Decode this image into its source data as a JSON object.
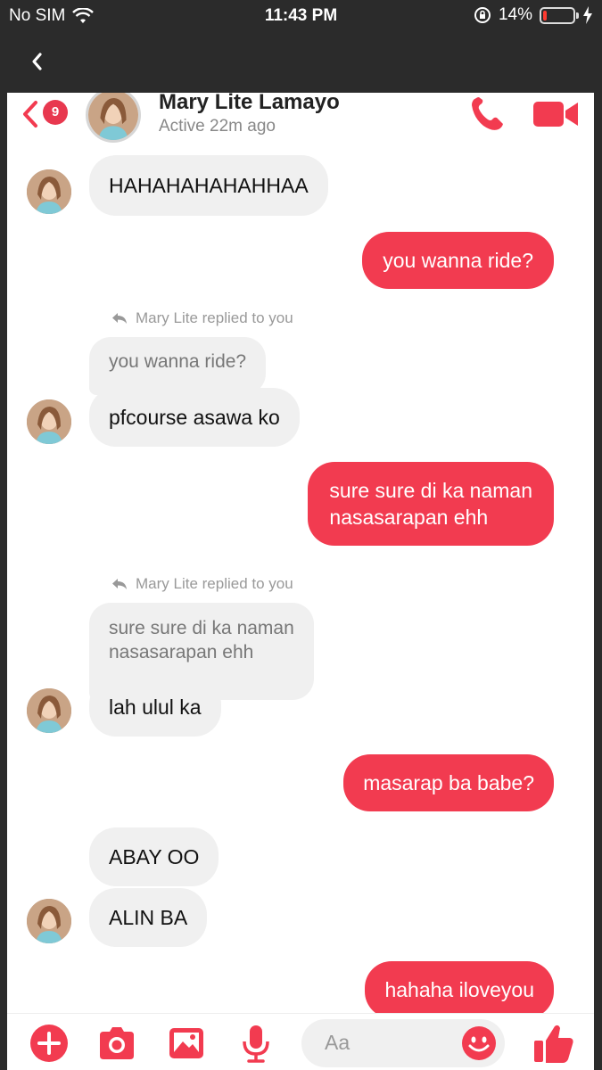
{
  "status_bar": {
    "carrier": "No SIM",
    "time": "11:43 PM",
    "battery": "14%",
    "battery_level": 0.14
  },
  "header": {
    "unread_count": "9",
    "contact_name": "Mary Lite Lamayo",
    "active_status": "Active 22m ago"
  },
  "messages": [
    {
      "side": "in",
      "text": "HAHAHAHAHAHHAA"
    },
    {
      "side": "out",
      "text": "you wanna ride?"
    },
    {
      "reply_note": "Mary Lite replied to you",
      "quoted": "you wanna ride?",
      "side": "in",
      "text": "pfcourse asawa ko"
    },
    {
      "side": "out",
      "lines": [
        "sure sure di ka naman",
        "nasasarapan ehh"
      ]
    },
    {
      "reply_note": "Mary Lite replied to you",
      "quoted_lines": [
        "sure sure di ka naman",
        "nasasarapan ehh"
      ],
      "side": "in",
      "text": "lah ulul ka"
    },
    {
      "side": "out",
      "text": "masarap ba babe?"
    },
    {
      "side": "in",
      "text": "ABAY OO"
    },
    {
      "side": "in",
      "text": "ALIN BA"
    },
    {
      "side": "out",
      "text": "hahaha iloveyou"
    }
  ],
  "composer": {
    "placeholder": "Aa",
    "icons": [
      "plus-icon",
      "camera-icon",
      "gallery-icon",
      "microphone-icon",
      "emoji-icon",
      "thumbs-up-icon"
    ]
  },
  "colors": {
    "accent": "#f23b50",
    "incoming_bubble": "#f0f0f0",
    "status_bar": "#2b2b2b"
  }
}
